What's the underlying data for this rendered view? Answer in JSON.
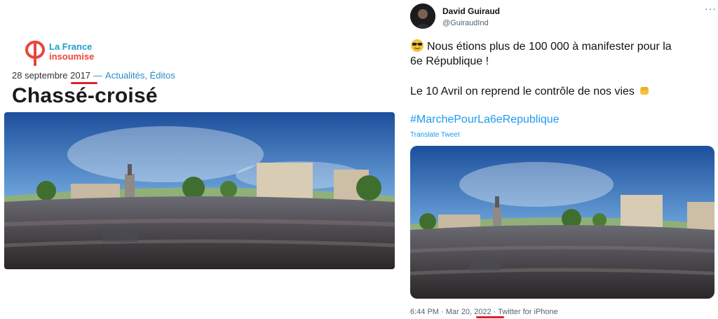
{
  "article": {
    "logo_line1": "La France",
    "logo_line2": "insoumise",
    "date_prefix": "28 septembre ",
    "year": "2017",
    "separator": "—",
    "categories": "Actualités, Éditos",
    "title": "Chassé-croisé",
    "photo_icon": "panorama-crowd-place-de-la-republique"
  },
  "tweet": {
    "author_name": "David Guiraud",
    "author_handle": "@GuiraudInd",
    "line1": "Nous étions plus de 100 000 à manifester pour la",
    "line2": "6e République !",
    "line3": "Le 10 Avril on reprend le contrôle de nos vies",
    "hashtag": "#MarchePourLa6eRepublique",
    "translate": "Translate Tweet",
    "time": "6:44 PM · Mar 20, ",
    "year": "2022",
    "source": " · Twitter for iPhone",
    "emoji_start": "sunglasses-face-icon",
    "emoji_end": "raised-fist-icon",
    "photo_icon": "panorama-crowd-place-de-la-republique"
  },
  "colors": {
    "highlight_underline": "#d9242a",
    "twitter_link": "#1d9bf0",
    "lfi_blue": "#1ea0c8",
    "lfi_red": "#e8453c"
  }
}
